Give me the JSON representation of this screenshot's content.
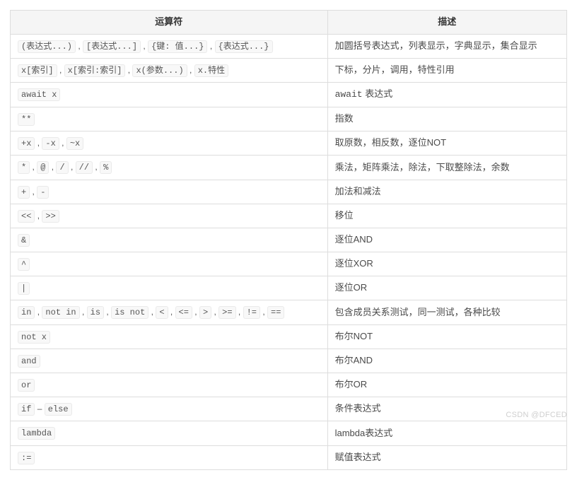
{
  "headers": {
    "operator": "运算符",
    "description": "描述"
  },
  "rows": [
    {
      "ops": [
        "(表达式...)",
        "[表达式...]",
        "{键: 值...}",
        "{表达式...}"
      ],
      "desc": "加圆括号表达式，列表显示，字典显示，集合显示"
    },
    {
      "ops": [
        "x[索引]",
        "x[索引:索引]",
        "x(参数...)",
        "x.特性"
      ],
      "desc": "下标，分片，调用，特性引用"
    },
    {
      "ops": [
        "await x"
      ],
      "desc_code": "await",
      "desc_after": " 表达式"
    },
    {
      "ops": [
        "**"
      ],
      "desc": "指数"
    },
    {
      "ops": [
        "+x",
        "-x",
        "~x"
      ],
      "desc": "取原数，相反数，逐位NOT"
    },
    {
      "ops": [
        "*",
        "@",
        "/",
        "//",
        "%"
      ],
      "desc": "乘法，矩阵乘法，除法，下取整除法，余数"
    },
    {
      "ops": [
        "+",
        "-"
      ],
      "desc": "加法和减法"
    },
    {
      "ops": [
        "<<",
        ">>"
      ],
      "desc": "移位"
    },
    {
      "ops": [
        "&"
      ],
      "desc": "逐位AND"
    },
    {
      "ops": [
        "^"
      ],
      "desc": "逐位XOR"
    },
    {
      "ops": [
        "|"
      ],
      "desc": "逐位OR"
    },
    {
      "ops": [
        "in",
        "not in",
        "is",
        "is not",
        "<",
        "<=",
        ">",
        ">=",
        "!=",
        "=="
      ],
      "desc": "包含成员关系测试，同一测试，各种比较"
    },
    {
      "ops": [
        "not x"
      ],
      "desc": "布尔NOT"
    },
    {
      "ops": [
        "and"
      ],
      "desc": "布尔AND"
    },
    {
      "ops": [
        "or"
      ],
      "desc": "布尔OR"
    },
    {
      "ops": [
        "if"
      ],
      "ops_sep": " – ",
      "ops2": [
        "else"
      ],
      "desc": "条件表达式"
    },
    {
      "ops": [
        "lambda"
      ],
      "desc": "lambda表达式"
    },
    {
      "ops": [
        ":="
      ],
      "desc": "赋值表达式"
    }
  ],
  "watermark": "CSDN @DFCED"
}
